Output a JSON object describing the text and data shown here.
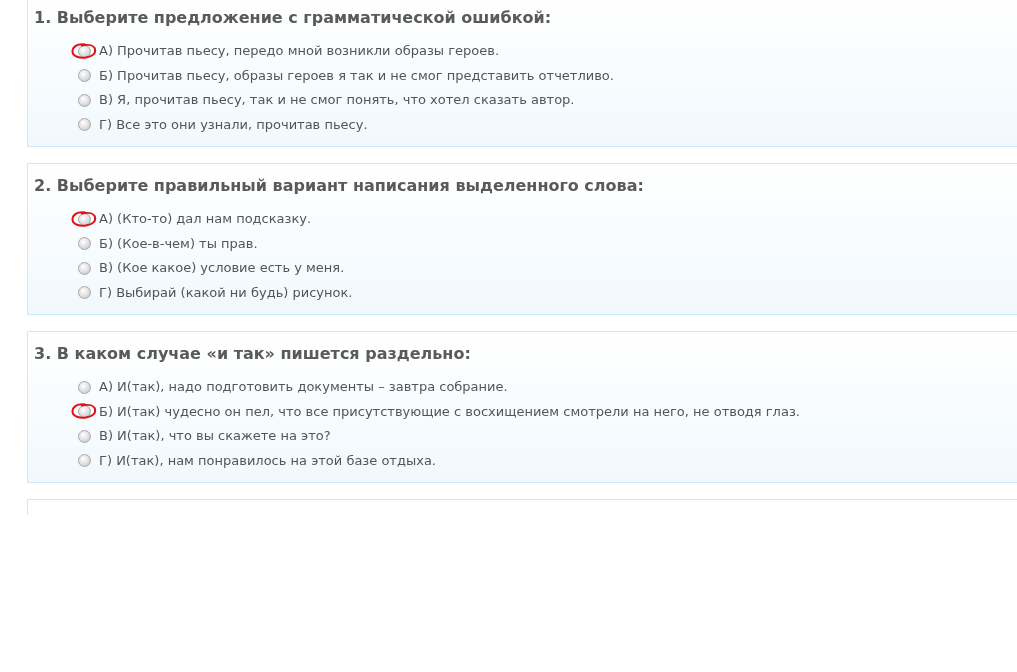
{
  "questions": [
    {
      "title": "1. Выберите предложение с грамматической ошибкой:",
      "options": [
        {
          "text": "А) Прочитав пьесу, передо мной возникли образы героев.",
          "selected": false,
          "marked": true
        },
        {
          "text": "Б) Прочитав пьесу, образы героев я так и не смог представить отчетливо.",
          "selected": false,
          "marked": false
        },
        {
          "text": "В) Я, прочитав пьесу, так и не смог понять, что хотел сказать автор.",
          "selected": false,
          "marked": false
        },
        {
          "text": "Г) Все это они узнали, прочитав пьесу.",
          "selected": false,
          "marked": false
        }
      ]
    },
    {
      "title": "2. Выберите правильный вариант написания выделенного слова:",
      "options": [
        {
          "text": "А) (Кто-то) дал нам подсказку.",
          "selected": false,
          "marked": true
        },
        {
          "text": "Б) (Кое-в-чем) ты прав.",
          "selected": false,
          "marked": false
        },
        {
          "text": "В) (Кое какое) условие есть у меня.",
          "selected": false,
          "marked": false
        },
        {
          "text": "Г) Выбирай (какой ни будь) рисунок.",
          "selected": false,
          "marked": false
        }
      ]
    },
    {
      "title": "3. В каком случае «и так» пишется раздельно:",
      "options": [
        {
          "text": "А) И(так), надо подготовить документы – завтра собрание.",
          "selected": false,
          "marked": false
        },
        {
          "text": "Б) И(так) чудесно он пел, что все присутствующие с восхищением смотрели на него, не отводя глаз.",
          "selected": false,
          "marked": true
        },
        {
          "text": "В) И(так), что вы скажете на это?",
          "selected": false,
          "marked": false
        },
        {
          "text": "Г) И(так), нам понравилось на этой базе отдыха.",
          "selected": false,
          "marked": false
        }
      ]
    }
  ],
  "next_question_cut_off": true
}
